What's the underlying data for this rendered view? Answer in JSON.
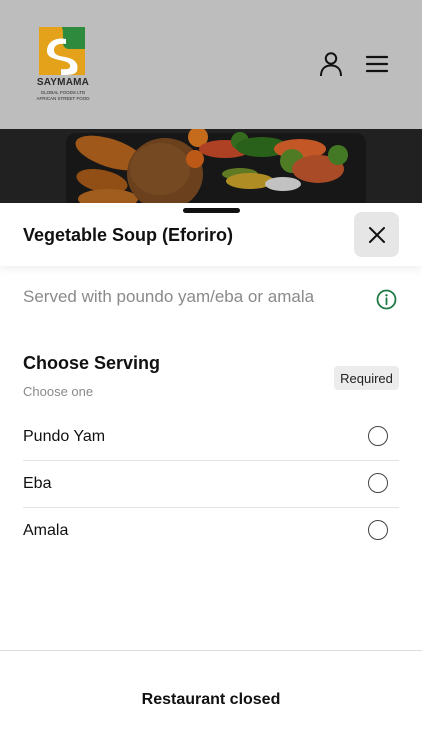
{
  "brand": {
    "name": "SAYMAMA",
    "tagline_1": "GLOBAL FOODS LTD",
    "tagline_2": "AFRICAN STREET FOOD",
    "colors": {
      "orange": "#e3a21a",
      "green": "#2e8b3e",
      "dark": "#2b2b2b"
    }
  },
  "header": {
    "icons": [
      "user-icon",
      "hamburger-menu-icon"
    ]
  },
  "sheet": {
    "title": "Vegetable Soup (Eforiro)",
    "description": "Served with poundo yam/eba or amala",
    "section": {
      "title": "Choose Serving",
      "subtitle": "Choose one",
      "badge": "Required",
      "options": [
        {
          "label": "Pundo Yam",
          "selected": false
        },
        {
          "label": "Eba",
          "selected": false
        },
        {
          "label": "Amala",
          "selected": false
        }
      ]
    },
    "footer_status": "Restaurant closed",
    "accent_color": "#1e7a45"
  }
}
